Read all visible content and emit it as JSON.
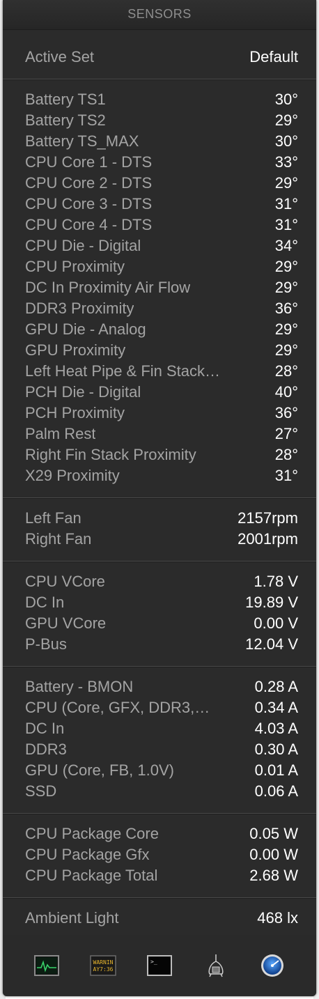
{
  "window": {
    "title": "SENSORS"
  },
  "active_set": {
    "label": "Active Set",
    "value": "Default"
  },
  "temperatures": [
    {
      "label": "Battery TS1",
      "value": "30°"
    },
    {
      "label": "Battery TS2",
      "value": "29°"
    },
    {
      "label": "Battery TS_MAX",
      "value": "30°"
    },
    {
      "label": "CPU Core 1 - DTS",
      "value": "33°"
    },
    {
      "label": "CPU Core 2 - DTS",
      "value": "29°"
    },
    {
      "label": "CPU Core 3 - DTS",
      "value": "31°"
    },
    {
      "label": "CPU Core 4 - DTS",
      "value": "31°"
    },
    {
      "label": "CPU Die - Digital",
      "value": "34°"
    },
    {
      "label": "CPU Proximity",
      "value": "29°"
    },
    {
      "label": "DC In Proximity Air Flow",
      "value": "29°"
    },
    {
      "label": "DDR3 Proximity",
      "value": "36°"
    },
    {
      "label": "GPU Die - Analog",
      "value": "29°"
    },
    {
      "label": "GPU Proximity",
      "value": "29°"
    },
    {
      "label": "Left Heat Pipe & Fin Stack…",
      "value": "28°"
    },
    {
      "label": "PCH Die - Digital",
      "value": "40°"
    },
    {
      "label": "PCH Proximity",
      "value": "36°"
    },
    {
      "label": "Palm Rest",
      "value": "27°"
    },
    {
      "label": "Right Fin Stack Proximity",
      "value": "28°"
    },
    {
      "label": "X29 Proximity",
      "value": "31°"
    }
  ],
  "fans": [
    {
      "label": "Left Fan",
      "value": "2157rpm"
    },
    {
      "label": "Right Fan",
      "value": "2001rpm"
    }
  ],
  "voltages": [
    {
      "label": "CPU VCore",
      "value": "1.78 V"
    },
    {
      "label": "DC In",
      "value": "19.89 V"
    },
    {
      "label": "GPU VCore",
      "value": "0.00 V"
    },
    {
      "label": "P-Bus",
      "value": "12.04 V"
    }
  ],
  "currents": [
    {
      "label": "Battery - BMON",
      "value": "0.28 A"
    },
    {
      "label": "CPU (Core, GFX, DDR3,…",
      "value": "0.34 A"
    },
    {
      "label": "DC In",
      "value": "4.03 A"
    },
    {
      "label": "DDR3",
      "value": "0.30 A"
    },
    {
      "label": "GPU (Core, FB, 1.0V)",
      "value": "0.01 A"
    },
    {
      "label": "SSD",
      "value": "0.06 A"
    }
  ],
  "power": [
    {
      "label": "CPU Package Core",
      "value": "0.05 W"
    },
    {
      "label": "CPU Package Gfx",
      "value": "0.00 W"
    },
    {
      "label": "CPU Package Total",
      "value": "2.68 W"
    }
  ],
  "light": [
    {
      "label": "Ambient Light",
      "value": "468 lx"
    }
  ],
  "toolbar": {
    "icons": [
      "activity-monitor-icon",
      "console-icon",
      "terminal-icon",
      "system-information-icon",
      "network-utility-icon"
    ],
    "console_text_line1": "WARNIN",
    "console_text_line2": "AY7:36"
  },
  "colors": {
    "panel_bg": "#2b2b2b",
    "label": "#a4a4a4",
    "value": "#ffffff",
    "title": "#8e8e8e"
  }
}
